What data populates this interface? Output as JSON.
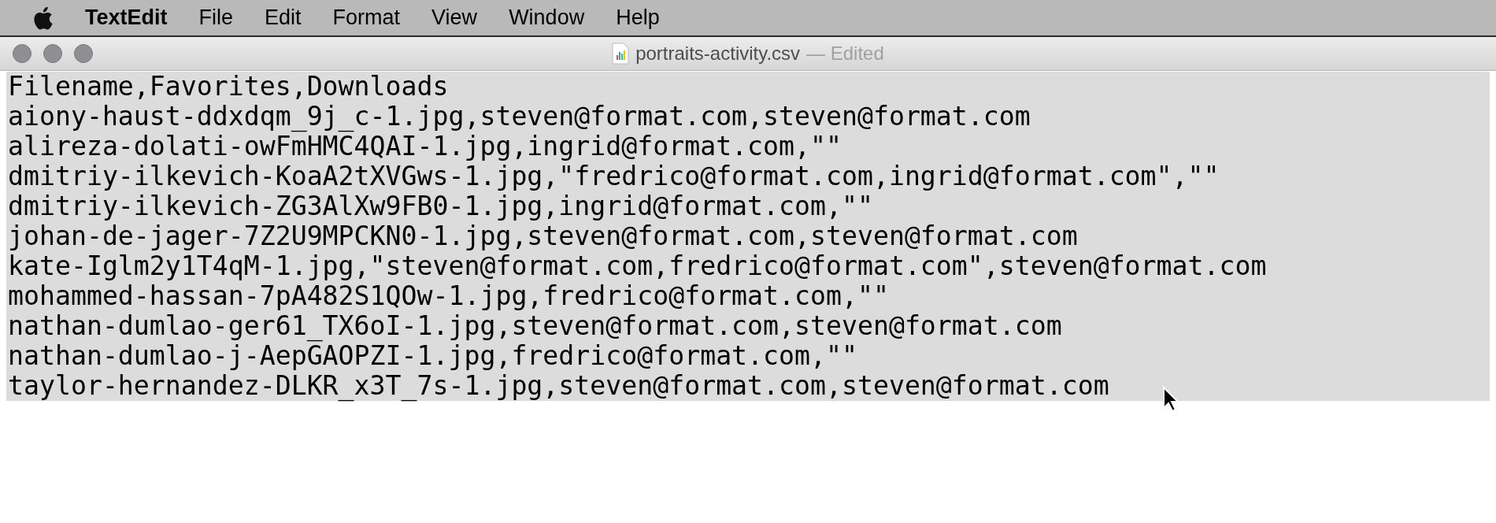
{
  "menu_bar": {
    "app_name": "TextEdit",
    "items": [
      "File",
      "Edit",
      "Format",
      "View",
      "Window",
      "Help"
    ]
  },
  "window": {
    "title": "portraits-activity.csv",
    "status": "— Edited"
  },
  "document": {
    "selected": true,
    "lines": [
      "Filename,Favorites,Downloads",
      "aiony-haust-ddxdqm_9j_c-1.jpg,steven@format.com,steven@format.com",
      "alireza-dolati-owFmHMC4QAI-1.jpg,ingrid@format.com,\"\"",
      "dmitriy-ilkevich-KoaA2tXVGws-1.jpg,\"fredrico@format.com,ingrid@format.com\",\"\"",
      "dmitriy-ilkevich-ZG3AlXw9FB0-1.jpg,ingrid@format.com,\"\"",
      "johan-de-jager-7Z2U9MPCKN0-1.jpg,steven@format.com,steven@format.com",
      "kate-Iglm2y1T4qM-1.jpg,\"steven@format.com,fredrico@format.com\",steven@format.com",
      "mohammed-hassan-7pA482S1QOw-1.jpg,fredrico@format.com,\"\"",
      "nathan-dumlao-ger61_TX6oI-1.jpg,steven@format.com,steven@format.com",
      "nathan-dumlao-j-AepGAOPZI-1.jpg,fredrico@format.com,\"\"",
      "taylor-hernandez-DLKR_x3T_7s-1.jpg,steven@format.com,steven@format.com"
    ]
  }
}
